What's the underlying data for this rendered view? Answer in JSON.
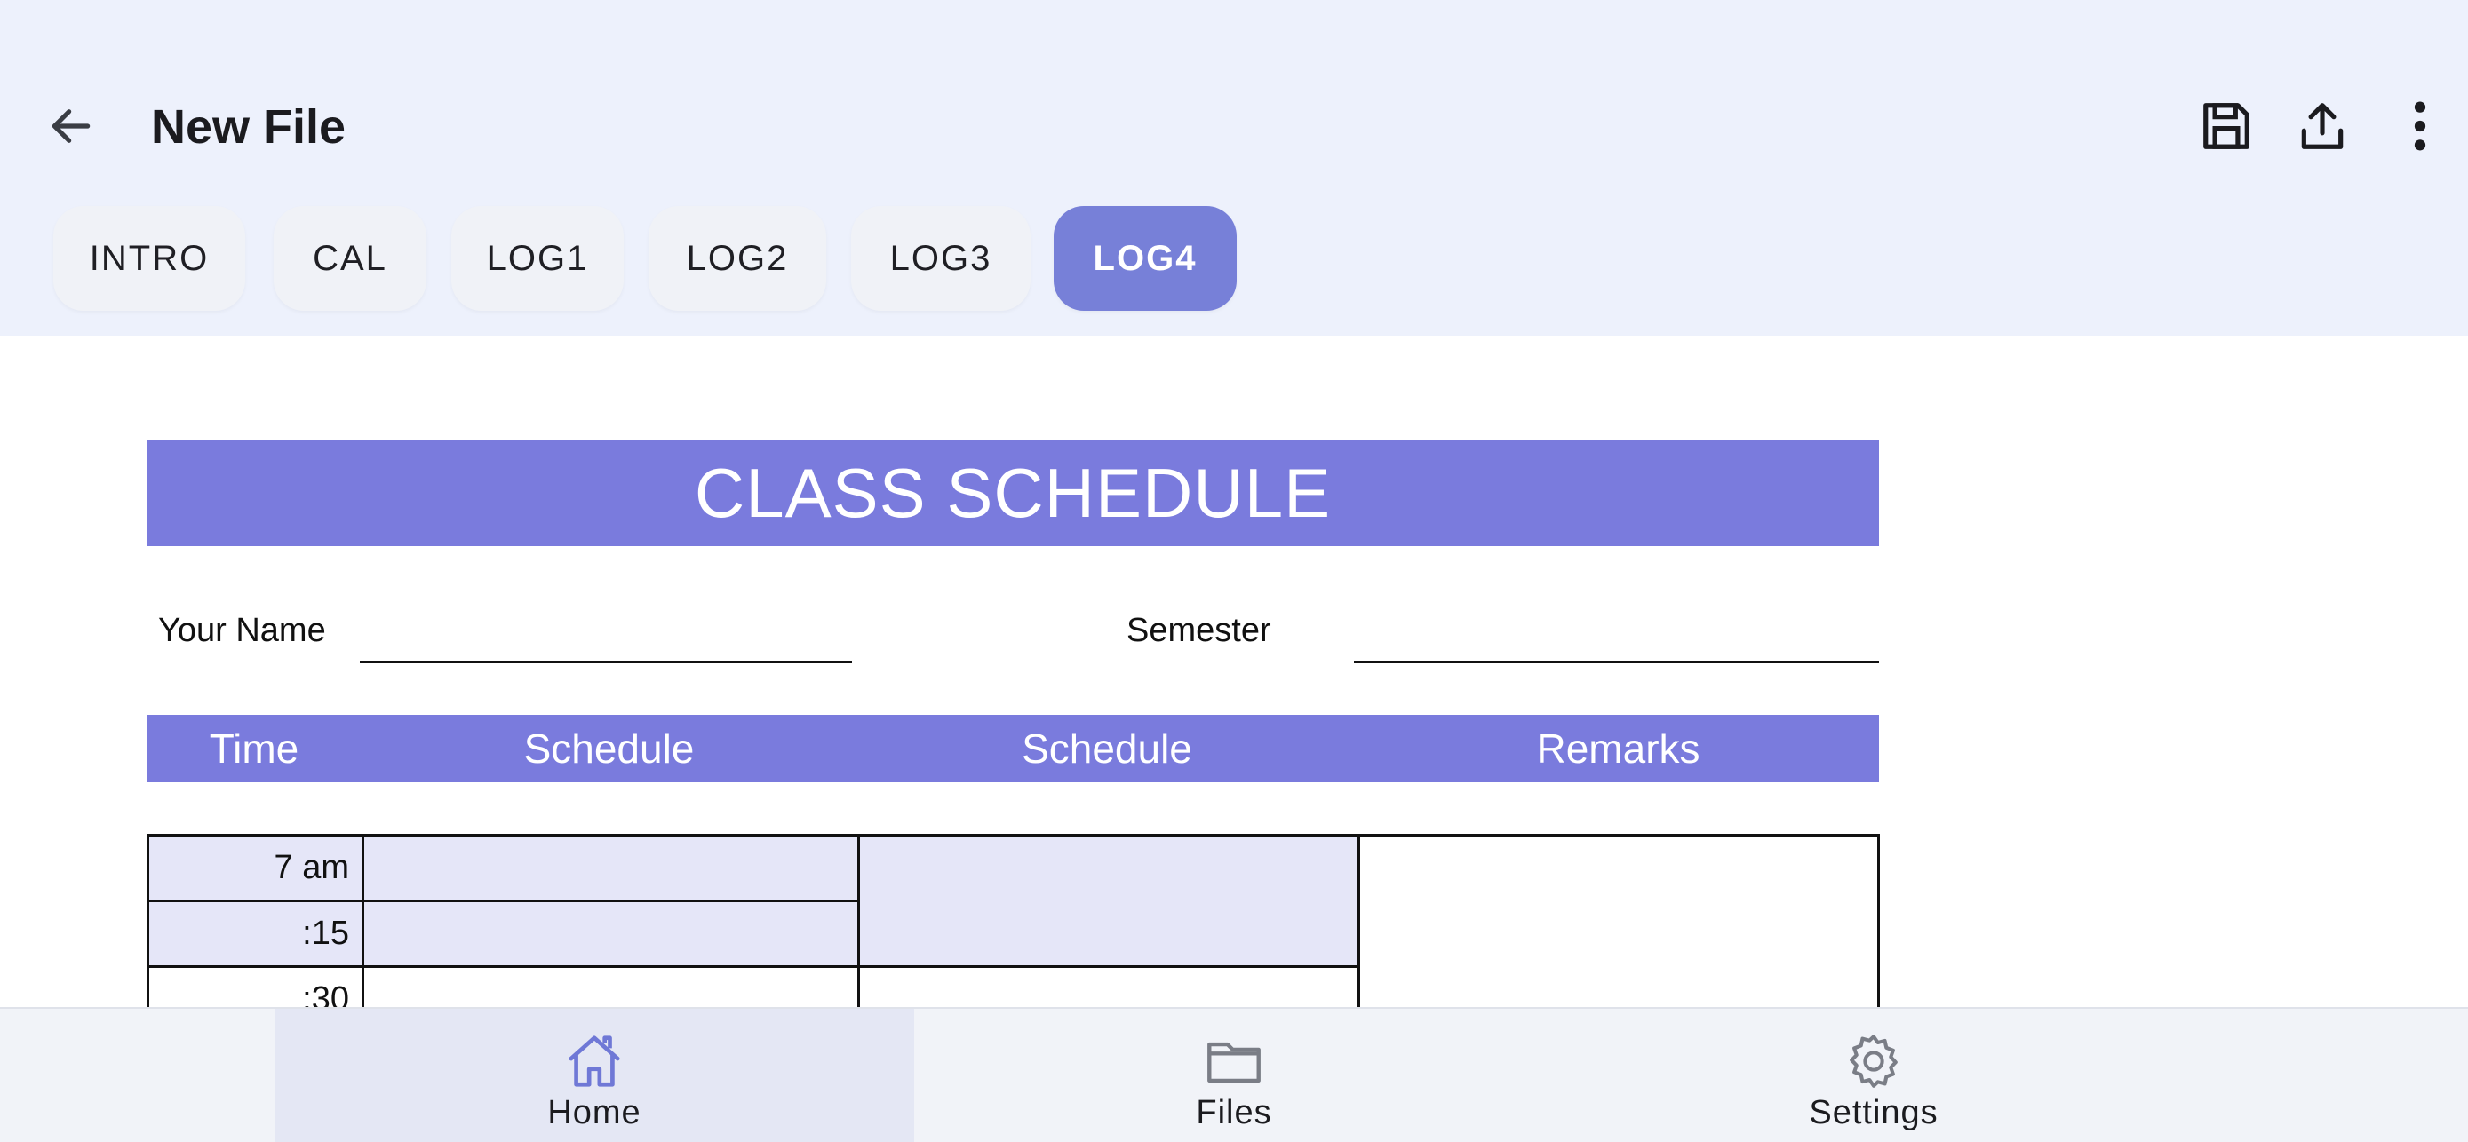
{
  "appbar": {
    "title": "New File",
    "tabs": [
      {
        "label": "INTRO"
      },
      {
        "label": "CAL"
      },
      {
        "label": "LOG1"
      },
      {
        "label": "LOG2"
      },
      {
        "label": "LOG3"
      },
      {
        "label": "LOG4",
        "active": true
      }
    ],
    "actions": [
      "save-icon",
      "share-icon",
      "more-vert-icon"
    ]
  },
  "document": {
    "title": "CLASS SCHEDULE",
    "name_label": "Your Name",
    "semester_label": "Semester",
    "columns": [
      "Time",
      "Schedule",
      "Schedule",
      "Remarks"
    ],
    "times": [
      "7 am",
      ":15",
      ":30"
    ]
  },
  "bottom_nav": {
    "items": [
      {
        "label": "Home",
        "icon": "home-icon",
        "active": true
      },
      {
        "label": "Files",
        "icon": "folder-icon"
      },
      {
        "label": "Settings",
        "icon": "gear-icon"
      }
    ]
  },
  "colors": {
    "accent": "#7a7bdd",
    "appbar_bg": "#edf1fc",
    "cell_shade": "#e5e6f8"
  }
}
